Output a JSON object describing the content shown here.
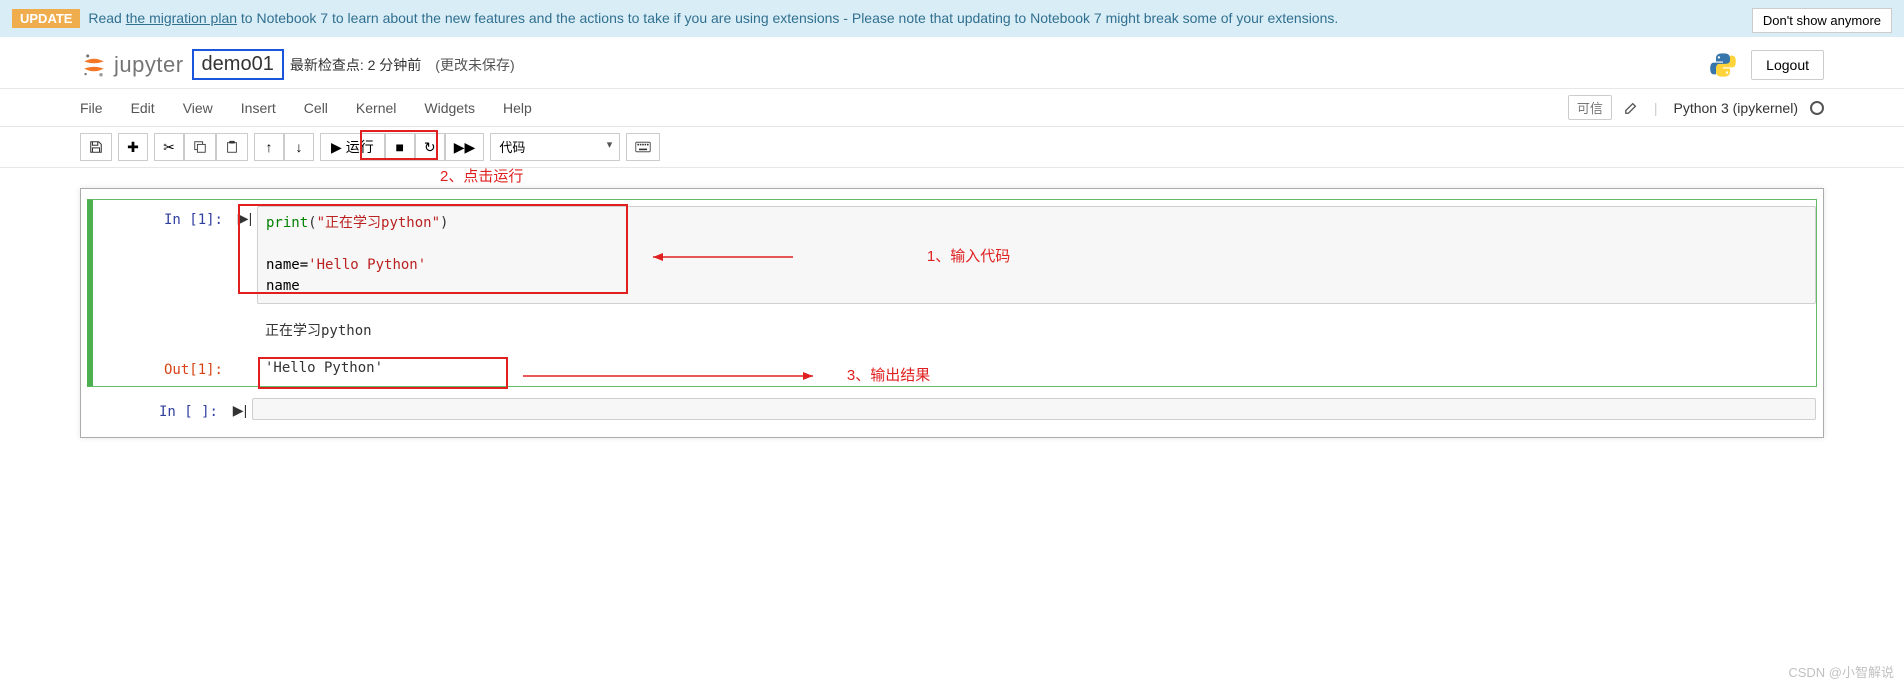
{
  "banner": {
    "badge": "UPDATE",
    "text_pre": " Read ",
    "link": "the migration plan",
    "text_post": " to Notebook 7 to learn about the new features and the actions to take if you are using extensions - Please note that updating to Notebook 7 might break some of your extensions.",
    "dismiss": "Don't show anymore"
  },
  "header": {
    "logo_text": "jupyter",
    "notebook_name": "demo01",
    "checkpoint": "最新检查点: 2 分钟前",
    "autosave": "(更改未保存)",
    "logout": "Logout"
  },
  "menu": {
    "items": [
      "File",
      "Edit",
      "View",
      "Insert",
      "Cell",
      "Kernel",
      "Widgets",
      "Help"
    ],
    "trusted": "可信",
    "kernel": "Python 3 (ipykernel)"
  },
  "toolbar": {
    "run_label": "运行",
    "cell_type": "代码",
    "run_annotation": "2、点击运行"
  },
  "cells": [
    {
      "in_prompt": "In [1]:",
      "code_line1_fn": "print",
      "code_line1_paren_open": "(",
      "code_line1_str": "\"正在学习python\"",
      "code_line1_paren_close": ")",
      "code_line3": "name=",
      "code_line3_str": "'Hello Python'",
      "code_line4": "name",
      "stdout": "正在学习python",
      "out_prompt": "Out[1]:",
      "out_value": "'Hello Python'"
    },
    {
      "in_prompt": "In [ ]:"
    }
  ],
  "annotations": {
    "input": "1、输入代码",
    "output": "3、输出结果"
  },
  "watermark": "CSDN @小智解说"
}
